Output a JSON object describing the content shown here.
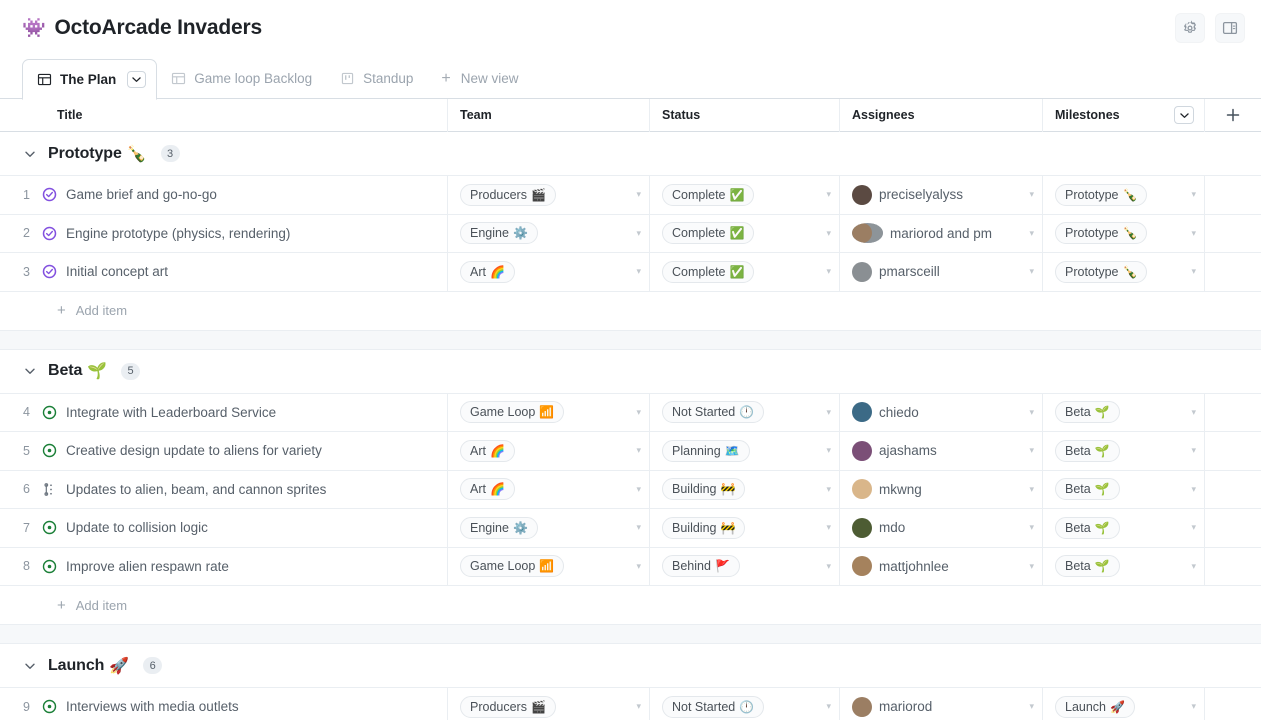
{
  "header": {
    "emoji": "👾",
    "title": "OctoArcade Invaders",
    "settings_title": "Settings",
    "panel_title": "Toggle panel"
  },
  "tabs": [
    {
      "label": "The Plan",
      "icon": "table-icon",
      "active": true,
      "has_caret": true
    },
    {
      "label": "Game loop Backlog",
      "icon": "table-icon",
      "active": false,
      "has_caret": false
    },
    {
      "label": "Standup",
      "icon": "board-icon",
      "active": false,
      "has_caret": false
    }
  ],
  "new_view": {
    "label": "New view",
    "icon": "plus-icon"
  },
  "columns": [
    {
      "key": "title",
      "label": "Title"
    },
    {
      "key": "team",
      "label": "Team"
    },
    {
      "key": "status",
      "label": "Status"
    },
    {
      "key": "assignees",
      "label": "Assignees"
    },
    {
      "key": "milestones",
      "label": "Milestones"
    }
  ],
  "add_column_label": "+",
  "add_item_label": "Add item",
  "groups": [
    {
      "name": "Prototype",
      "emoji": "🍾",
      "count": "3",
      "rows": [
        {
          "num": "1",
          "state": "closed",
          "title": "Game brief and go-no-go",
          "team": {
            "text": "Producers",
            "emoji": "🎬"
          },
          "status": {
            "text": "Complete",
            "emoji": "✅"
          },
          "assignees": {
            "text": "preciselyalyss",
            "avatars": [
              "#5b4a42"
            ]
          },
          "milestone": {
            "text": "Prototype",
            "emoji": "🍾"
          }
        },
        {
          "num": "2",
          "state": "closed",
          "title": "Engine prototype (physics, rendering)",
          "team": {
            "text": "Engine",
            "emoji": "⚙️"
          },
          "status": {
            "text": "Complete",
            "emoji": "✅"
          },
          "assignees": {
            "text": "mariorod and pm",
            "avatars": [
              "#9b7e63",
              "#8d9499"
            ]
          },
          "milestone": {
            "text": "Prototype",
            "emoji": "🍾"
          }
        },
        {
          "num": "3",
          "state": "closed",
          "title": "Initial concept art",
          "team": {
            "text": "Art",
            "emoji": "🌈"
          },
          "status": {
            "text": "Complete",
            "emoji": "✅"
          },
          "assignees": {
            "text": "pmarsceill",
            "avatars": [
              "#8a8f93"
            ]
          },
          "milestone": {
            "text": "Prototype",
            "emoji": "🍾"
          }
        }
      ]
    },
    {
      "name": "Beta",
      "emoji": "🌱",
      "count": "5",
      "rows": [
        {
          "num": "4",
          "state": "open",
          "title": "Integrate with Leaderboard Service",
          "team": {
            "text": "Game Loop",
            "emoji": "📶"
          },
          "status": {
            "text": "Not Started",
            "emoji": "🕛"
          },
          "assignees": {
            "text": "chiedo",
            "avatars": [
              "#3c6a86"
            ]
          },
          "milestone": {
            "text": "Beta",
            "emoji": "🌱"
          }
        },
        {
          "num": "5",
          "state": "open",
          "title": "Creative design update to aliens for variety",
          "team": {
            "text": "Art",
            "emoji": "🌈"
          },
          "status": {
            "text": "Planning",
            "emoji": "🗺️"
          },
          "assignees": {
            "text": "ajashams",
            "avatars": [
              "#7b4f77"
            ]
          },
          "milestone": {
            "text": "Beta",
            "emoji": "🌱"
          }
        },
        {
          "num": "6",
          "state": "draft",
          "title": "Updates to alien, beam, and cannon sprites",
          "team": {
            "text": "Art",
            "emoji": "🌈"
          },
          "status": {
            "text": "Building",
            "emoji": "🚧"
          },
          "assignees": {
            "text": "mkwng",
            "avatars": [
              "#d9b68a"
            ]
          },
          "milestone": {
            "text": "Beta",
            "emoji": "🌱"
          }
        },
        {
          "num": "7",
          "state": "open",
          "title": "Update to collision logic",
          "team": {
            "text": "Engine",
            "emoji": "⚙️"
          },
          "status": {
            "text": "Building",
            "emoji": "🚧"
          },
          "assignees": {
            "text": "mdo",
            "avatars": [
              "#4d5c33"
            ]
          },
          "milestone": {
            "text": "Beta",
            "emoji": "🌱"
          }
        },
        {
          "num": "8",
          "state": "open",
          "title": "Improve alien respawn rate",
          "team": {
            "text": "Game Loop",
            "emoji": "📶"
          },
          "status": {
            "text": "Behind",
            "emoji": "🚩"
          },
          "assignees": {
            "text": "mattjohnlee",
            "avatars": [
              "#a5825d"
            ]
          },
          "milestone": {
            "text": "Beta",
            "emoji": "🌱"
          }
        }
      ]
    },
    {
      "name": "Launch",
      "emoji": "🚀",
      "count": "6",
      "rows": [
        {
          "num": "9",
          "state": "open",
          "title": "Interviews with media outlets",
          "team": {
            "text": "Producers",
            "emoji": "🎬"
          },
          "status": {
            "text": "Not Started",
            "emoji": "🕛"
          },
          "assignees": {
            "text": "mariorod",
            "avatars": [
              "#9b7e63"
            ]
          },
          "milestone": {
            "text": "Launch",
            "emoji": "🚀"
          }
        }
      ]
    }
  ],
  "colors": {
    "closed_icon": "#8250df",
    "open_icon": "#1a7f37",
    "draft_icon": "#6e7781",
    "border": "#d8dee4",
    "row_border": "#eaeef2",
    "group_gap": "#f6f8fa"
  }
}
